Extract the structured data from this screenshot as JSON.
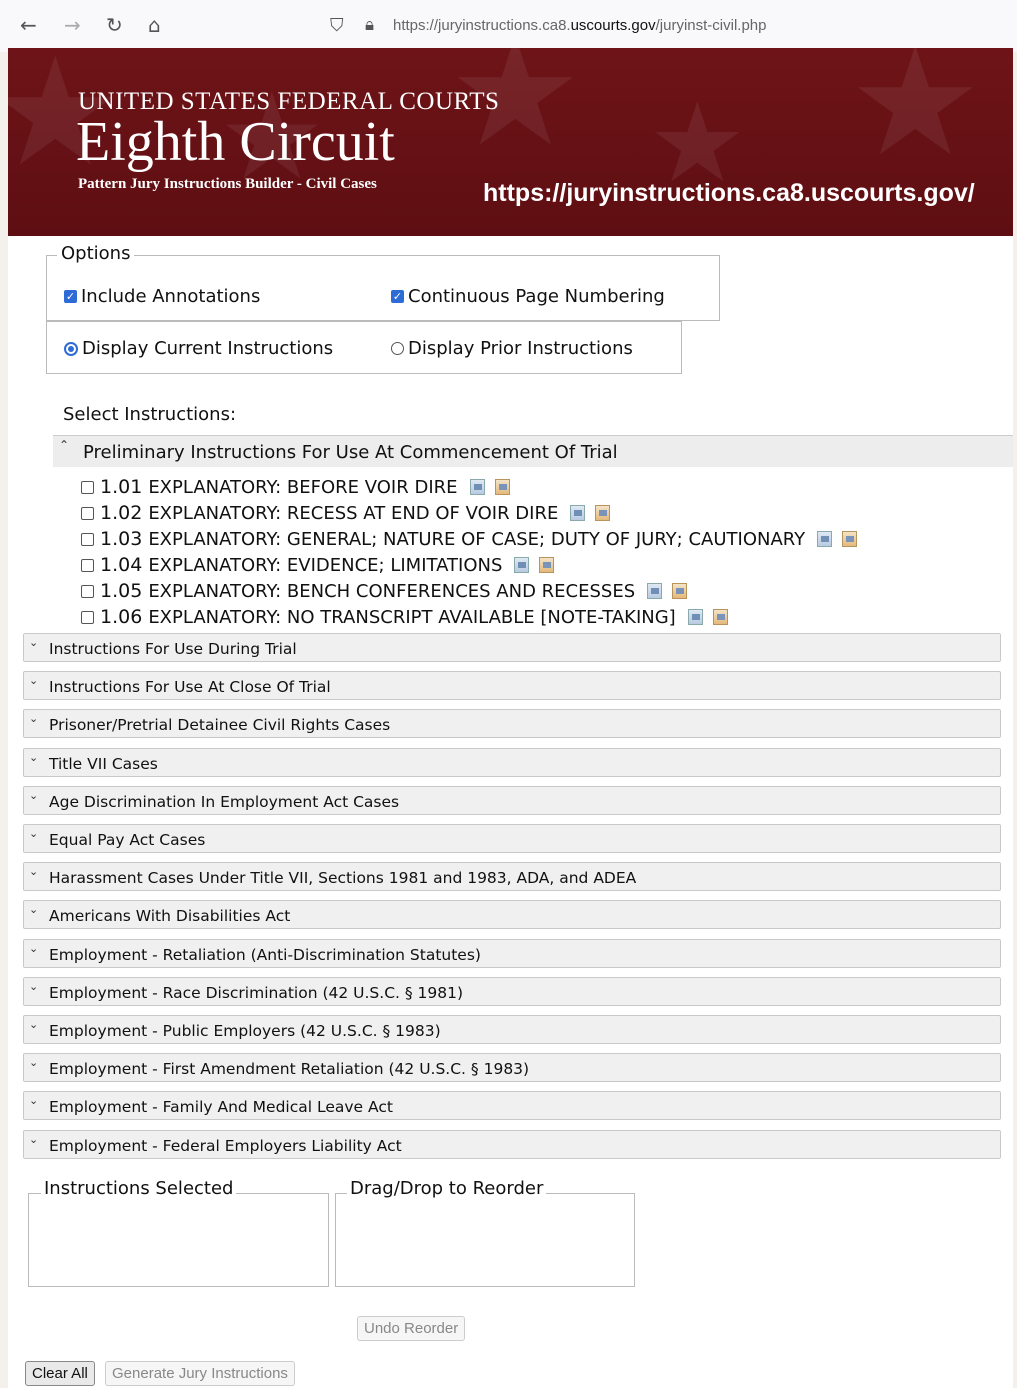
{
  "browser": {
    "url_prefix": "https://juryinstructions.ca8.",
    "url_domain": "uscourts.gov",
    "url_path": "/juryinst-civil.php"
  },
  "banner": {
    "line1": "UNITED STATES FEDERAL COURTS",
    "line2": "Eighth Circuit",
    "line3": "Pattern Jury Instructions Builder - Civil Cases",
    "url_overlay": "https://juryinstructions.ca8.uscourts.gov/"
  },
  "options": {
    "legend": "Options",
    "include_annotations": "Include Annotations",
    "continuous_numbering": "Continuous Page Numbering",
    "display_current": "Display Current Instructions",
    "display_prior": "Display Prior Instructions"
  },
  "select_label": "Select Instructions:",
  "open_section": {
    "title": "Preliminary Instructions For Use At Commencement Of Trial",
    "items": [
      {
        "num": "1.01",
        "text": "EXPLANATORY: BEFORE VOIR DIRE"
      },
      {
        "num": "1.02",
        "text": "EXPLANATORY: RECESS AT END OF VOIR DIRE"
      },
      {
        "num": "1.03",
        "text": "EXPLANATORY: GENERAL; NATURE OF CASE; DUTY OF JURY; CAUTIONARY"
      },
      {
        "num": "1.04",
        "text": "EXPLANATORY: EVIDENCE; LIMITATIONS"
      },
      {
        "num": "1.05",
        "text": "EXPLANATORY: BENCH CONFERENCES AND RECESSES"
      },
      {
        "num": "1.06",
        "text": "EXPLANATORY: NO TRANSCRIPT AVAILABLE [NOTE-TAKING]"
      }
    ]
  },
  "sections": [
    "Instructions For Use During Trial",
    "Instructions For Use At Close Of Trial",
    "Prisoner/Pretrial Detainee Civil Rights Cases",
    "Title VII Cases",
    "Age Discrimination In Employment Act Cases",
    "Equal Pay Act Cases",
    "Harassment Cases Under Title VII, Sections 1981 and 1983, ADA, and ADEA",
    "Americans With Disabilities Act",
    "Employment - Retaliation (Anti-Discrimination Statutes)",
    "Employment - Race Discrimination (42 U.S.C. § 1981)",
    "Employment - Public Employers (42 U.S.C. § 1983)",
    "Employment - First Amendment Retaliation (42 U.S.C. § 1983)",
    "Employment - Family And Medical Leave Act",
    "Employment - Federal Employers Liability Act"
  ],
  "boxes": {
    "selected": "Instructions Selected",
    "reorder": "Drag/Drop to Reorder"
  },
  "buttons": {
    "undo": "Undo Reorder",
    "clear": "Clear All",
    "generate": "Generate Jury Instructions"
  },
  "colors": {
    "banner": "#6e1418",
    "accent": "#2d6bd6"
  }
}
